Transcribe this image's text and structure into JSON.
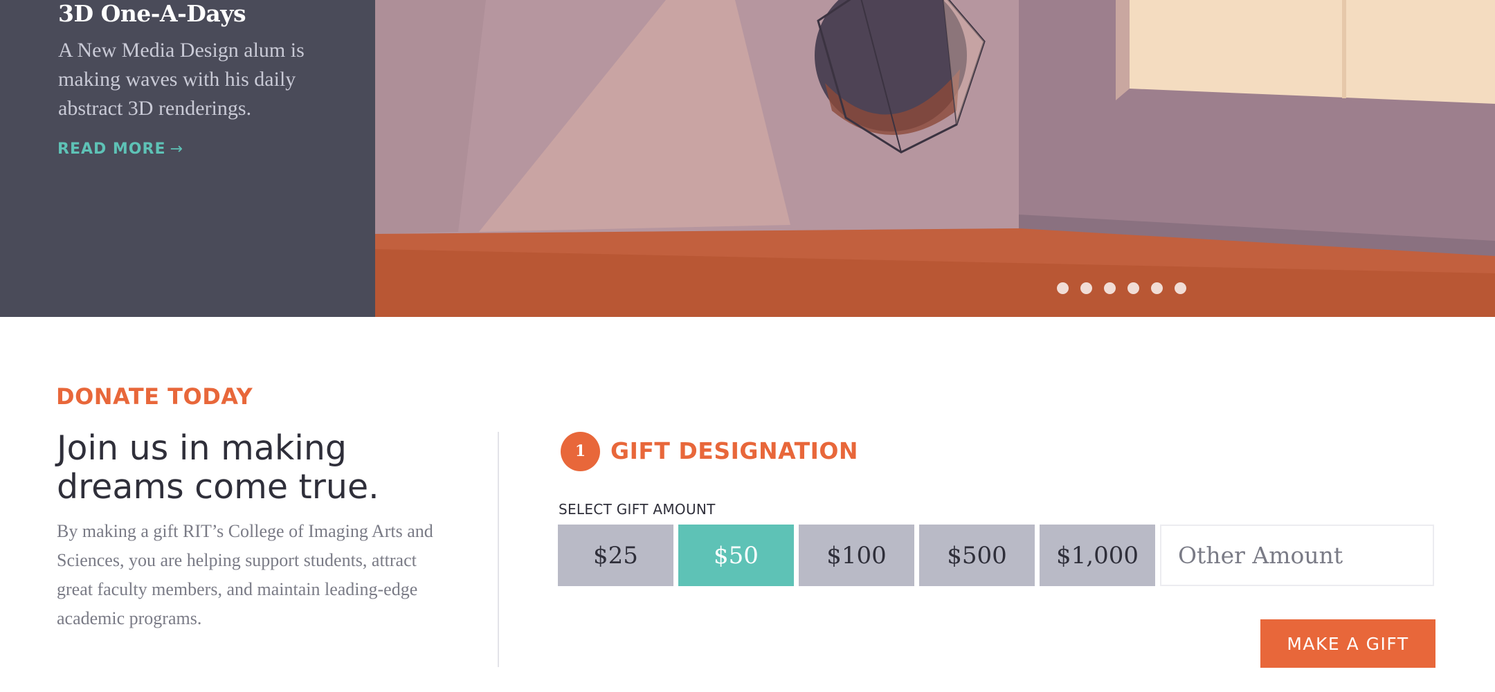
{
  "hero": {
    "title": "3D One-A-Days",
    "description": "A New Media Design alum is making waves with his daily abstract 3D renderings.",
    "read_more": "READ MORE",
    "read_more_icon": "arrow-right-icon",
    "slide_count": 6
  },
  "donate": {
    "eyebrow": "DONATE TODAY",
    "headline": "Join us in making dreams come true.",
    "body": "By making a gift RIT’s College of Imaging Arts and Sciences, you are helping support students, attract great faculty members, and maintain leading-edge academic programs."
  },
  "gift_form": {
    "step_number": "1",
    "step_title": "GIFT DESIGNATION",
    "amount_label": "SELECT GIFT AMOUNT",
    "amounts": [
      "$25",
      "$50",
      "$100",
      "$500",
      "$1,000"
    ],
    "selected_amount": "$50",
    "other_placeholder": "Other Amount",
    "submit_label": "MAKE A GIFT"
  },
  "colors": {
    "accent_orange": "#e8673a",
    "accent_teal": "#5ec2b6",
    "panel_dark": "#4a4b59",
    "amount_gray": "#b9bac6",
    "text_dark": "#2f2f3a"
  }
}
